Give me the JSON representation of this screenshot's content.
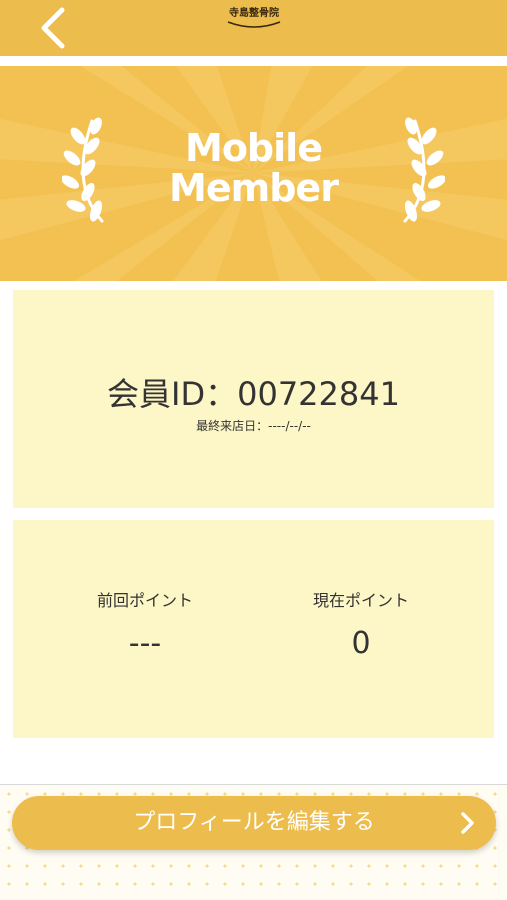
{
  "header": {
    "logo_text": "寺島整骨院",
    "logo_sub": "ー・ー・ー・ー"
  },
  "hero": {
    "title_line1": "Mobile",
    "title_line2": "Member"
  },
  "member": {
    "id_text": "会員ID：00722841",
    "last_visit": "最終来店日：----/--/--"
  },
  "points": {
    "previous_label": "前回ポイント",
    "previous_value": "---",
    "current_label": "現在ポイント",
    "current_value": "0"
  },
  "actions": {
    "profile_edit": "プロフィールを編集する"
  },
  "colors": {
    "header": "#ecbc4c",
    "hero": "#f2c152",
    "card": "#fdf6c6",
    "button": "#ecbc4c"
  },
  "icons": {
    "back": "chevron-left-icon",
    "laurel": "laurel-icon",
    "forward": "chevron-right-icon"
  }
}
